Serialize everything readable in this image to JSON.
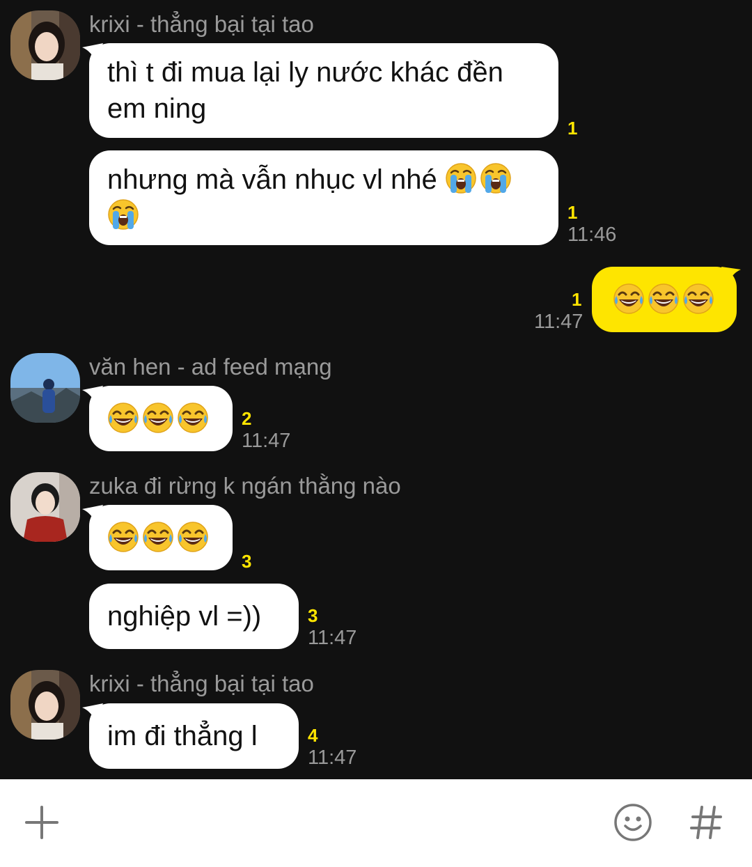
{
  "messages": {
    "m1": {
      "sender": "krixi - thẳng bại tại tao",
      "bubble1": {
        "line1": "thì t đi mua lại ly nước khác đền",
        "line2": "em ning",
        "unread": "1"
      },
      "bubble2": {
        "text": "nhưng mà vẫn nhục vl nhé",
        "emoji_count": 3,
        "unread": "1",
        "time": "11:46"
      }
    },
    "m2": {
      "emoji_count": 3,
      "unread": "1",
      "time": "11:47"
    },
    "m3": {
      "sender": "văn hen - ad feed mạng",
      "emoji_count": 3,
      "unread": "2",
      "time": "11:47"
    },
    "m4": {
      "sender": "zuka đi rừng k ngán thằng nào",
      "bubble1": {
        "emoji_count": 3,
        "unread": "3"
      },
      "bubble2": {
        "text": "nghiệp vl =))",
        "unread": "3",
        "time": "11:47"
      }
    },
    "m5": {
      "sender": "krixi - thẳng bại tại tao",
      "text": "im đi thẳng l",
      "unread": "4",
      "time": "11:47"
    }
  },
  "icons": {
    "crying": "loudly-crying-face-emoji",
    "laughing": "face-with-tears-of-joy-emoji",
    "add": "plus-icon",
    "emoticon": "smiley-icon",
    "hashtag": "hashtag-icon"
  },
  "colors": {
    "background": "#111111",
    "my_bubble": "#fee500",
    "their_bubble": "#ffffff",
    "unread": "#fee500",
    "timestamp": "#9a9a9a"
  }
}
